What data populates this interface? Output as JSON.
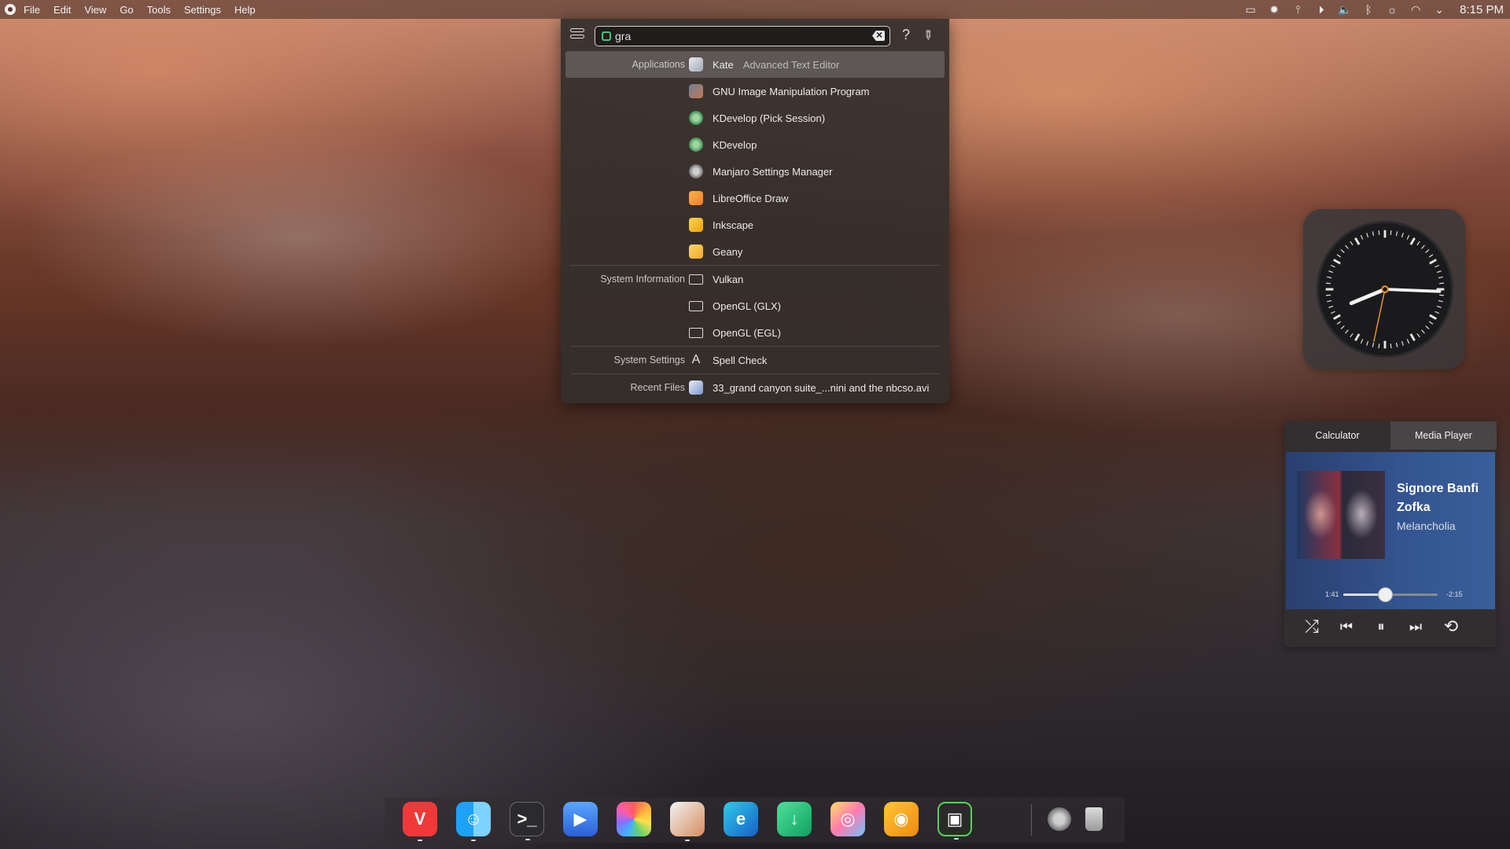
{
  "menubar": {
    "items": [
      "File",
      "Edit",
      "View",
      "Go",
      "Tools",
      "Settings",
      "Help"
    ],
    "time": "8:15 PM",
    "tray_icons": [
      "window-icon",
      "gear-icon",
      "paperclip-icon",
      "play-icon",
      "volume-icon",
      "bluetooth-icon",
      "brightness-icon",
      "wifi-icon",
      "chevron-down-icon"
    ]
  },
  "krunner": {
    "query": "gra",
    "help_label": "?",
    "results": [
      {
        "category": "Applications",
        "name": "Kate",
        "subtitle": "Advanced Text Editor",
        "icon": "kate-icon",
        "selected": true
      },
      {
        "category": "",
        "name": "GNU Image Manipulation Program",
        "subtitle": "",
        "icon": "gimp-icon"
      },
      {
        "category": "",
        "name": "KDevelop (Pick Session)",
        "subtitle": "",
        "icon": "kdevelop-icon"
      },
      {
        "category": "",
        "name": "KDevelop",
        "subtitle": "",
        "icon": "kdevelop-icon"
      },
      {
        "category": "",
        "name": "Manjaro Settings Manager",
        "subtitle": "",
        "icon": "manjaro-settings-icon"
      },
      {
        "category": "",
        "name": "LibreOffice Draw",
        "subtitle": "",
        "icon": "libreoffice-draw-icon"
      },
      {
        "category": "",
        "name": "Inkscape",
        "subtitle": "",
        "icon": "inkscape-icon"
      },
      {
        "category": "",
        "name": "Geany",
        "subtitle": "",
        "icon": "geany-icon"
      },
      {
        "category": "System Information",
        "name": "Vulkan",
        "subtitle": "",
        "icon": "monitor-icon"
      },
      {
        "category": "",
        "name": "OpenGL (GLX)",
        "subtitle": "",
        "icon": "monitor-icon"
      },
      {
        "category": "",
        "name": "OpenGL (EGL)",
        "subtitle": "",
        "icon": "monitor-icon"
      },
      {
        "category": "System Settings",
        "name": "Spell Check",
        "subtitle": "",
        "icon": "spell-check-icon"
      },
      {
        "category": "Recent Files",
        "name": "33_grand canyon suite_...nini and the nbcso.avi",
        "subtitle": "",
        "icon": "video-file-icon"
      }
    ]
  },
  "clock": {
    "hours": 8,
    "minutes": 15,
    "seconds": 22
  },
  "media_player": {
    "tabs": [
      "Calculator",
      "Media Player"
    ],
    "active_tab": "Media Player",
    "title": "Signore Banfi",
    "artist": "Zofka",
    "album": "Melancholia",
    "elapsed": "1:41",
    "remaining": "-2:15",
    "progress": 0.44,
    "controls": [
      "shuffle-icon",
      "previous-icon",
      "pause-icon",
      "next-icon",
      "repeat-icon"
    ]
  },
  "dock": {
    "apps": [
      {
        "name": "vivaldi-icon",
        "glyph": "V",
        "running": true
      },
      {
        "name": "finder-icon",
        "glyph": "☺",
        "running": true
      },
      {
        "name": "terminal-icon",
        "glyph": ">_",
        "running": true
      },
      {
        "name": "video-player-icon",
        "glyph": "▶",
        "running": false
      },
      {
        "name": "photos-icon",
        "glyph": "",
        "running": false
      },
      {
        "name": "gimp-icon",
        "glyph": "",
        "running": true
      },
      {
        "name": "edge-icon",
        "glyph": "e",
        "running": false
      },
      {
        "name": "downloader-icon",
        "glyph": "↓",
        "running": false
      },
      {
        "name": "color-picker-icon",
        "glyph": "◎",
        "running": false
      },
      {
        "name": "dvd-icon",
        "glyph": "◉",
        "running": false
      },
      {
        "name": "radio-icon",
        "glyph": "▣",
        "running": true
      }
    ],
    "system": [
      {
        "name": "settings-icon"
      },
      {
        "name": "trash-icon"
      }
    ]
  }
}
